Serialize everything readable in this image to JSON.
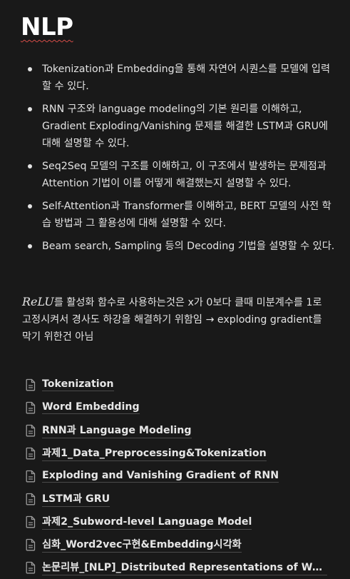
{
  "title": "NLP",
  "bullets": [
    "Tokenization과 Embedding을 통해 자연어 시퀀스를 모델에 입력할 수 있다.",
    "RNN 구조와 language modeling의 기본 원리를 이해하고, Gradient Exploding/Vanishing 문제를 해결한 LSTM과 GRU에 대해 설명할 수 있다.",
    "Seq2Seq 모델의 구조를 이해하고, 이 구조에서 발생하는 문제점과 Attention 기법이 이를 어떻게 해결했는지 설명할 수 있다.",
    "Self-Attention과 Transformer를 이해하고, BERT 모델의 사전 학습 방법과 그 활용성에 대해 설명할 수 있다.",
    "Beam search, Sampling 등의 Decoding 기법을 설명할 수 있다."
  ],
  "note": {
    "math": "ReLU",
    "text": "를 활성화 함수로 사용하는것은 x가 0보다 클때 미분계수를 1로 고정시켜서 경사도 하강을 해결하기 위함임 → exploding gradient를 막기 위한건 아님"
  },
  "pages": [
    "Tokenization",
    "Word Embedding",
    "RNN과 Language Modeling",
    "과제1_Data_Preprocessing&Tokenization",
    "Exploding and Vanishing Gradient of RNN",
    "LSTM과 GRU",
    "과제2_Subword-level Language Model",
    "심화_Word2vec구현&Embedding시각화",
    "논문리뷰_[NLP]_Distributed Representations of Words and Phrases and their Compositionality"
  ],
  "icon": "page-icon"
}
